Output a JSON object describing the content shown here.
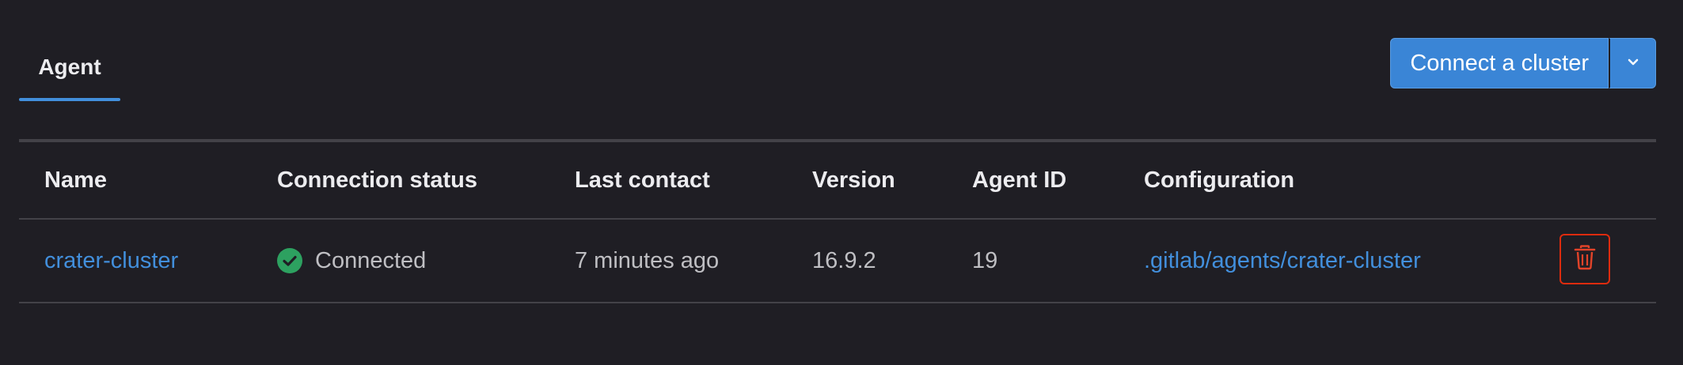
{
  "tabs": [
    {
      "label": "Agent",
      "active": true
    }
  ],
  "actions": {
    "connect_label": "Connect a cluster",
    "dropdown_icon": "chevron-down-icon"
  },
  "table": {
    "columns": [
      "Name",
      "Connection status",
      "Last contact",
      "Version",
      "Agent ID",
      "Configuration"
    ],
    "rows": [
      {
        "name": "crater-cluster",
        "status": "Connected",
        "status_icon": "check-circle-icon",
        "last_contact": "7 minutes ago",
        "version": "16.9.2",
        "agent_id": "19",
        "configuration": ".gitlab/agents/crater-cluster",
        "delete_icon": "trash-icon"
      }
    ]
  },
  "colors": {
    "background": "#1f1e24",
    "accent": "#428fdc",
    "primary_button": "#3a85d6",
    "success": "#2da160",
    "danger": "#dd2b0e",
    "border": "#434248"
  }
}
